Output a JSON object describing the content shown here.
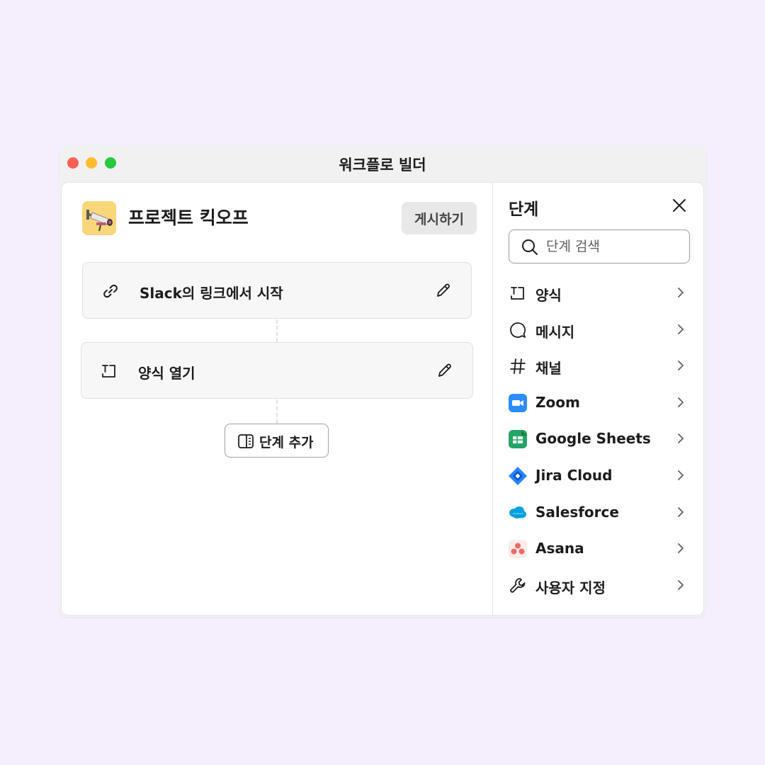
{
  "window": {
    "title": "워크플로 빌더"
  },
  "workflow": {
    "name": "프로젝트 킥오프",
    "publish_label": "게시하기",
    "steps": [
      {
        "label": "Slack의 링크에서 시작",
        "icon": "link-icon"
      },
      {
        "label": "양식 열기",
        "icon": "form-icon"
      }
    ],
    "add_step_label": "단계 추가"
  },
  "panel": {
    "title": "단계",
    "search_placeholder": "단계 검색",
    "items": [
      {
        "label": "양식",
        "icon": "form-icon"
      },
      {
        "label": "메시지",
        "icon": "message-bubble-icon"
      },
      {
        "label": "채널",
        "icon": "hash-icon"
      },
      {
        "label": "Zoom",
        "icon": "zoom-icon"
      },
      {
        "label": "Google Sheets",
        "icon": "google-sheets-icon"
      },
      {
        "label": "Jira Cloud",
        "icon": "jira-icon"
      },
      {
        "label": "Salesforce",
        "icon": "salesforce-icon"
      },
      {
        "label": "Asana",
        "icon": "asana-icon"
      },
      {
        "label": "사용자 지정",
        "icon": "wrench-icon"
      }
    ]
  },
  "colors": {
    "background": "#f5eefc",
    "zoom": "#2d8cff",
    "google_sheets": "#23a566",
    "jira": "#2684ff",
    "salesforce": "#00a1e0",
    "asana": "#f06a6a"
  }
}
